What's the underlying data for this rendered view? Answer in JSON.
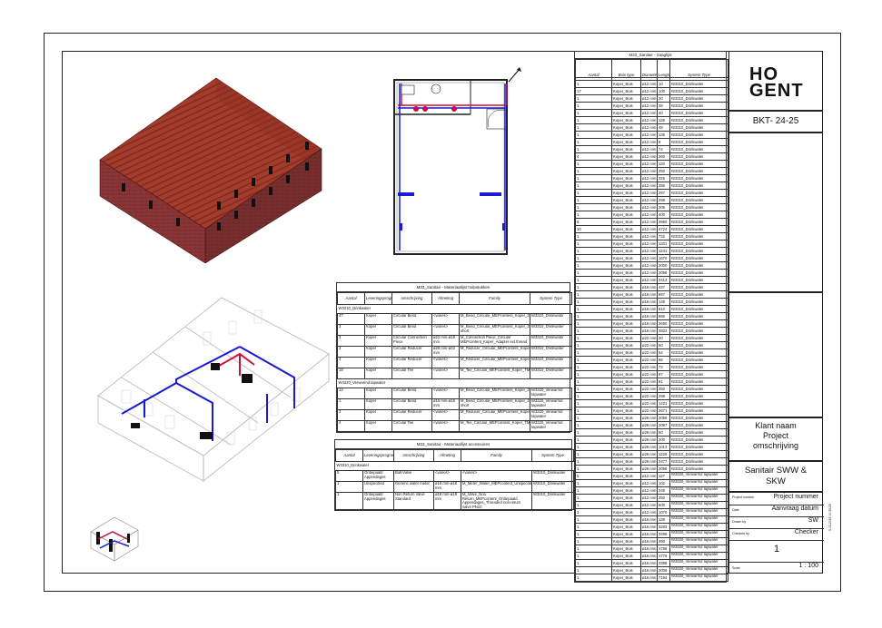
{
  "title_block": {
    "logo_line1": "HO",
    "logo_line2": "GENT",
    "code": "BKT- 24-25",
    "client_block": "Klant naam\nProject\nomschrijving",
    "sheet_name": "Sanitair SWW &\nSKW",
    "rows": [
      {
        "label": "Project number",
        "value": "Project nummer"
      },
      {
        "label": "Date",
        "value": "Aanvraag datum"
      },
      {
        "label": "Drawn by",
        "value": "SW"
      },
      {
        "label": "Checked by",
        "value": "Checker"
      }
    ],
    "sheet_number": "1",
    "scale_label": "Scale",
    "scale_value": "1 : 100",
    "side_text": "5-03-2025 10:35:25"
  },
  "saw_schedule": {
    "title": "M33_Sanitair - Zaaglijst",
    "headers": [
      "Aantal",
      "Buis type",
      "Diamete r",
      "Lengte",
      "System Type"
    ],
    "rows": [
      [
        "1",
        "Koper_Buis",
        "ø12 mm",
        "10",
        "W3310_Drinkwater"
      ],
      [
        "17",
        "Koper_Buis",
        "ø12 mm",
        "100",
        "W3310_Drinkwater"
      ],
      [
        "1",
        "Koper_Buis",
        "ø12 mm",
        "30",
        "W3310_Drinkwater"
      ],
      [
        "1",
        "Koper_Buis",
        "ø12 mm",
        "38",
        "W3310_Drinkwater"
      ],
      [
        "1",
        "Koper_Buis",
        "ø12 mm",
        "40",
        "W3310_Drinkwater"
      ],
      [
        "1",
        "Koper_Buis",
        "ø12 mm",
        "128",
        "W3310_Drinkwater"
      ],
      [
        "1",
        "Koper_Buis",
        "ø12 mm",
        "48",
        "W3310_Drinkwater"
      ],
      [
        "1",
        "Koper_Buis",
        "ø12 mm",
        "135",
        "W3310_Drinkwater"
      ],
      [
        "1",
        "Koper_Buis",
        "ø12 mm",
        "8",
        "W3310_Drinkwater"
      ],
      [
        "1",
        "Koper_Buis",
        "ø12 mm",
        "74",
        "W3310_Drinkwater"
      ],
      [
        "4",
        "Koper_Buis",
        "ø12 mm",
        "260",
        "W3310_Drinkwater"
      ],
      [
        "1",
        "Koper_Buis",
        "ø12 mm",
        "120",
        "W3310_Drinkwater"
      ],
      [
        "1",
        "Koper_Buis",
        "ø12 mm",
        "250",
        "W3310_Drinkwater"
      ],
      [
        "1",
        "Koper_Buis",
        "ø12 mm",
        "225",
        "W3310_Drinkwater"
      ],
      [
        "1",
        "Koper_Buis",
        "ø12 mm",
        "286",
        "W3310_Drinkwater"
      ],
      [
        "1",
        "Koper_Buis",
        "ø12 mm",
        "297",
        "W3310_Drinkwater"
      ],
      [
        "1",
        "Koper_Buis",
        "ø12 mm",
        "298",
        "W3310_Drinkwater"
      ],
      [
        "1",
        "Koper_Buis",
        "ø12 mm",
        "305",
        "W3310_Drinkwater"
      ],
      [
        "1",
        "Koper_Buis",
        "ø12 mm",
        "400",
        "W3310_Drinkwater"
      ],
      [
        "6",
        "Koper_Buis",
        "ø12 mm",
        "3960",
        "W3310_Drinkwater"
      ],
      [
        "10",
        "Koper_Buis",
        "ø12 mm",
        "4724",
        "W3310_Drinkwater"
      ],
      [
        "1",
        "Koper_Buis",
        "ø12 mm",
        "722",
        "W3310_Drinkwater"
      ],
      [
        "1",
        "Koper_Buis",
        "ø12 mm",
        "1331",
        "W3310_Drinkwater"
      ],
      [
        "1",
        "Koper_Buis",
        "ø12 mm",
        "1241",
        "W3310_Drinkwater"
      ],
      [
        "1",
        "Koper_Buis",
        "ø12 mm",
        "1670",
        "W3310_Drinkwater"
      ],
      [
        "1",
        "Koper_Buis",
        "ø12 mm",
        "2000",
        "W3310_Drinkwater"
      ],
      [
        "1",
        "Koper_Buis",
        "ø12 mm",
        "3096",
        "W3310_Drinkwater"
      ],
      [
        "1",
        "Koper_Buis",
        "ø12 mm",
        "2413",
        "W3310_Drinkwater"
      ],
      [
        "1",
        "Koper_Buis",
        "ø18 mm",
        "437",
        "W3310_Drinkwater"
      ],
      [
        "1",
        "Koper_Buis",
        "ø18 mm",
        "697",
        "W3310_Drinkwater"
      ],
      [
        "1",
        "Koper_Buis",
        "ø18 mm",
        "149",
        "W3310_Drinkwater"
      ],
      [
        "1",
        "Koper_Buis",
        "ø18 mm",
        "610",
        "W3310_Drinkwater"
      ],
      [
        "1",
        "Koper_Buis",
        "ø18 mm",
        "886",
        "W3310_Drinkwater"
      ],
      [
        "1",
        "Koper_Buis",
        "ø18 mm",
        "2660",
        "W3310_Drinkwater"
      ],
      [
        "1",
        "Koper_Buis",
        "ø18 mm",
        "3823",
        "W3310_Drinkwater"
      ],
      [
        "1",
        "Koper_Buis",
        "ø22 mm",
        "20",
        "W3310_Drinkwater"
      ],
      [
        "1",
        "Koper_Buis",
        "ø22 mm",
        "50",
        "W3310_Drinkwater"
      ],
      [
        "1",
        "Koper_Buis",
        "ø22 mm",
        "54",
        "W3310_Drinkwater"
      ],
      [
        "1",
        "Koper_Buis",
        "ø22 mm",
        "86",
        "W3310_Drinkwater"
      ],
      [
        "1",
        "Koper_Buis",
        "ø22 mm",
        "73",
        "W3310_Drinkwater"
      ],
      [
        "1",
        "Koper_Buis",
        "ø22 mm",
        "97",
        "W3310_Drinkwater"
      ],
      [
        "1",
        "Koper_Buis",
        "ø22 mm",
        "91",
        "W3310_Drinkwater"
      ],
      [
        "1",
        "Koper_Buis",
        "ø22 mm",
        "350",
        "W3310_Drinkwater"
      ],
      [
        "1",
        "Koper_Buis",
        "ø22 mm",
        "298",
        "W3310_Drinkwater"
      ],
      [
        "1",
        "Koper_Buis",
        "ø22 mm",
        "1421",
        "W3310_Drinkwater"
      ],
      [
        "1",
        "Koper_Buis",
        "ø22 mm",
        "2671",
        "W3310_Drinkwater"
      ],
      [
        "1",
        "Koper_Buis",
        "ø28 mm",
        "3056",
        "W3310_Drinkwater"
      ],
      [
        "1",
        "Koper_Buis",
        "ø28 mm",
        "3087",
        "W3310_Drinkwater"
      ],
      [
        "1",
        "Koper_Buis",
        "ø28 mm",
        "50",
        "W3310_Drinkwater"
      ],
      [
        "1",
        "Koper_Buis",
        "ø28 mm",
        "300",
        "W3310_Drinkwater"
      ],
      [
        "1",
        "Koper_Buis",
        "ø28 mm",
        "1013",
        "W3310_Drinkwater"
      ],
      [
        "1",
        "Koper_Buis",
        "ø28 mm",
        "1228",
        "W3310_Drinkwater"
      ],
      [
        "1",
        "Koper_Buis",
        "ø28 mm",
        "2477",
        "W3310_Drinkwater"
      ],
      [
        "1",
        "Koper_Buis",
        "ø28 mm",
        "3096",
        "W3310_Drinkwater"
      ]
    ],
    "rows2": [
      [
        "5",
        "Koper_Buis",
        "ø12 mm",
        "127",
        "W3320_Verwarmd tapwater"
      ],
      [
        "1",
        "Koper_Buis",
        "ø12 mm",
        "102",
        "W3320_Verwarmd tapwater"
      ],
      [
        "1",
        "Koper_Buis",
        "ø12 mm",
        "249",
        "W3320_Verwarmd tapwater"
      ],
      [
        "1",
        "Koper_Buis",
        "ø12 mm",
        "250",
        "W3320_Verwarmd tapwater"
      ],
      [
        "1",
        "Koper_Buis",
        "ø12 mm",
        "600",
        "W3320_Verwarmd tapwater"
      ],
      [
        "3",
        "Koper_Buis",
        "ø12 mm",
        "1070",
        "W3320_Verwarmd tapwater"
      ],
      [
        "1",
        "Koper_Buis",
        "ø16 mm",
        "139",
        "W3320_Verwarmd tapwater"
      ],
      [
        "1",
        "Koper_Buis",
        "ø16 mm",
        "3283",
        "W3320_Verwarmd tapwater"
      ],
      [
        "1",
        "Koper_Buis",
        "ø16 mm",
        "3499",
        "W3320_Verwarmd tapwater"
      ],
      [
        "1",
        "Koper_Buis",
        "ø16 mm",
        "390",
        "W3320_Verwarmd tapwater"
      ],
      [
        "1",
        "Koper_Buis",
        "ø16 mm",
        "1758",
        "W3320_Verwarmd tapwater"
      ],
      [
        "1",
        "Koper_Buis",
        "ø16 mm",
        "1775",
        "W3320_Verwarmd tapwater"
      ],
      [
        "1",
        "Koper_Buis",
        "ø16 mm",
        "2398",
        "W3320_Verwarmd tapwater"
      ],
      [
        "1",
        "Koper_Buis",
        "ø16 mm",
        "3006",
        "W3320_Verwarmd tapwater"
      ],
      [
        "1",
        "Koper_Buis",
        "ø16 mm",
        "7194",
        "W3320_Verwarmd tapwater"
      ]
    ]
  },
  "fittings_schedule": {
    "title": "M33_Sanitair - Materiaallijst hulpstukken",
    "headers": [
      "Aantal",
      "Leveringsprogramma",
      "omschrijving",
      "Afmeting",
      "Family",
      "System Type"
    ],
    "groups": [
      {
        "name": "W3310_Drinkwater",
        "rows": [
          [
            "47",
            "Koper",
            "Circular Bend",
            "<varies>",
            "M_Bend_Circular_MEPcontent_Koper_2M",
            "W3310_Drinkwater"
          ],
          [
            "3",
            "Koper",
            "Circular Bend",
            "<varies>",
            "M_Bend_Circular_MEPcontent_Koper_2M short",
            "W3310_Drinkwater"
          ],
          [
            "3",
            "Koper",
            "Circular Connection Piece",
            "ø22 mm-ø18 mm",
            "M_Connection Piece_Circular MEPcontent_Koper_Adapter ext.thread",
            "W3310_Drinkwater"
          ],
          [
            "3",
            "Koper",
            "Circular Reducer",
            "ø28 mm-ø22 mm",
            "M_Reducer_Circular_MEPcontent_Koper_101",
            "W3310_Drinkwater"
          ],
          [
            "4",
            "Koper",
            "Circular Reducer",
            "<varies>",
            "M_Reducer_Circular_MEPcontent_Koper_MV",
            "W3310_Drinkwater"
          ],
          [
            "18",
            "Koper",
            "Circular Tee",
            "<varies>",
            "M_Tee_Circular_MEPcontent_Koper_TM",
            "W3310_Drinkwater"
          ]
        ]
      },
      {
        "name": "W3320_Verwarmd tapwater",
        "rows": [
          [
            "14",
            "Koper",
            "Circular Bend",
            "<varies>",
            "M_Bend_Circular_MEPcontent_Koper_2M",
            "W3320_Verwarmd tapwater"
          ],
          [
            "1",
            "Koper",
            "Circular Bend",
            "ø16 mm-ø16 mm",
            "M_Bend_Circular_MEPcontent_Koper_2M short",
            "W3320_Verwarmd tapwater"
          ],
          [
            "3",
            "Koper",
            "Circular Reducer",
            "<varies>",
            "M_Reducer_Circular_MEPcontent_Koper_MV",
            "W3320_Verwarmd tapwater"
          ],
          [
            "4",
            "Koper",
            "Circular Tee",
            "<varies>",
            "M_Tee_Circular_MEPcontent_Koper_TM",
            "W3320_Verwarmd tapwater"
          ]
        ]
      }
    ]
  },
  "accessories_schedule": {
    "title": "M33_Sanitair - Materiaallijst accessoires",
    "headers": [
      "Aantal",
      "Leveringsprogramma",
      "omschrijving",
      "Afmeting",
      "Family",
      "System Type"
    ],
    "groups": [
      {
        "name": "W3310_Drinkwater",
        "rows": [
          [
            "5",
            "Onbepaald Appendages",
            "Ball Valve",
            "<varies>",
            "<varies>",
            "W3310_Drinkwater"
          ],
          [
            "1",
            "Unspecified",
            "Generic water meter",
            "ø18 mm-ø18 mm",
            "M_Meter_Water_MEPcontent_Unspecified_G",
            "W3310_Drinkwater"
          ],
          [
            "1",
            "Onbepaald Appendages",
            "Non Return Valve Standard",
            "ø18 mm-ø18 mm",
            "M_Valve_Non Return_MEPcontent_Onbepaald Appendages_Threaded non-return valve PN10",
            "W3310_Drinkwater"
          ]
        ]
      }
    ]
  }
}
